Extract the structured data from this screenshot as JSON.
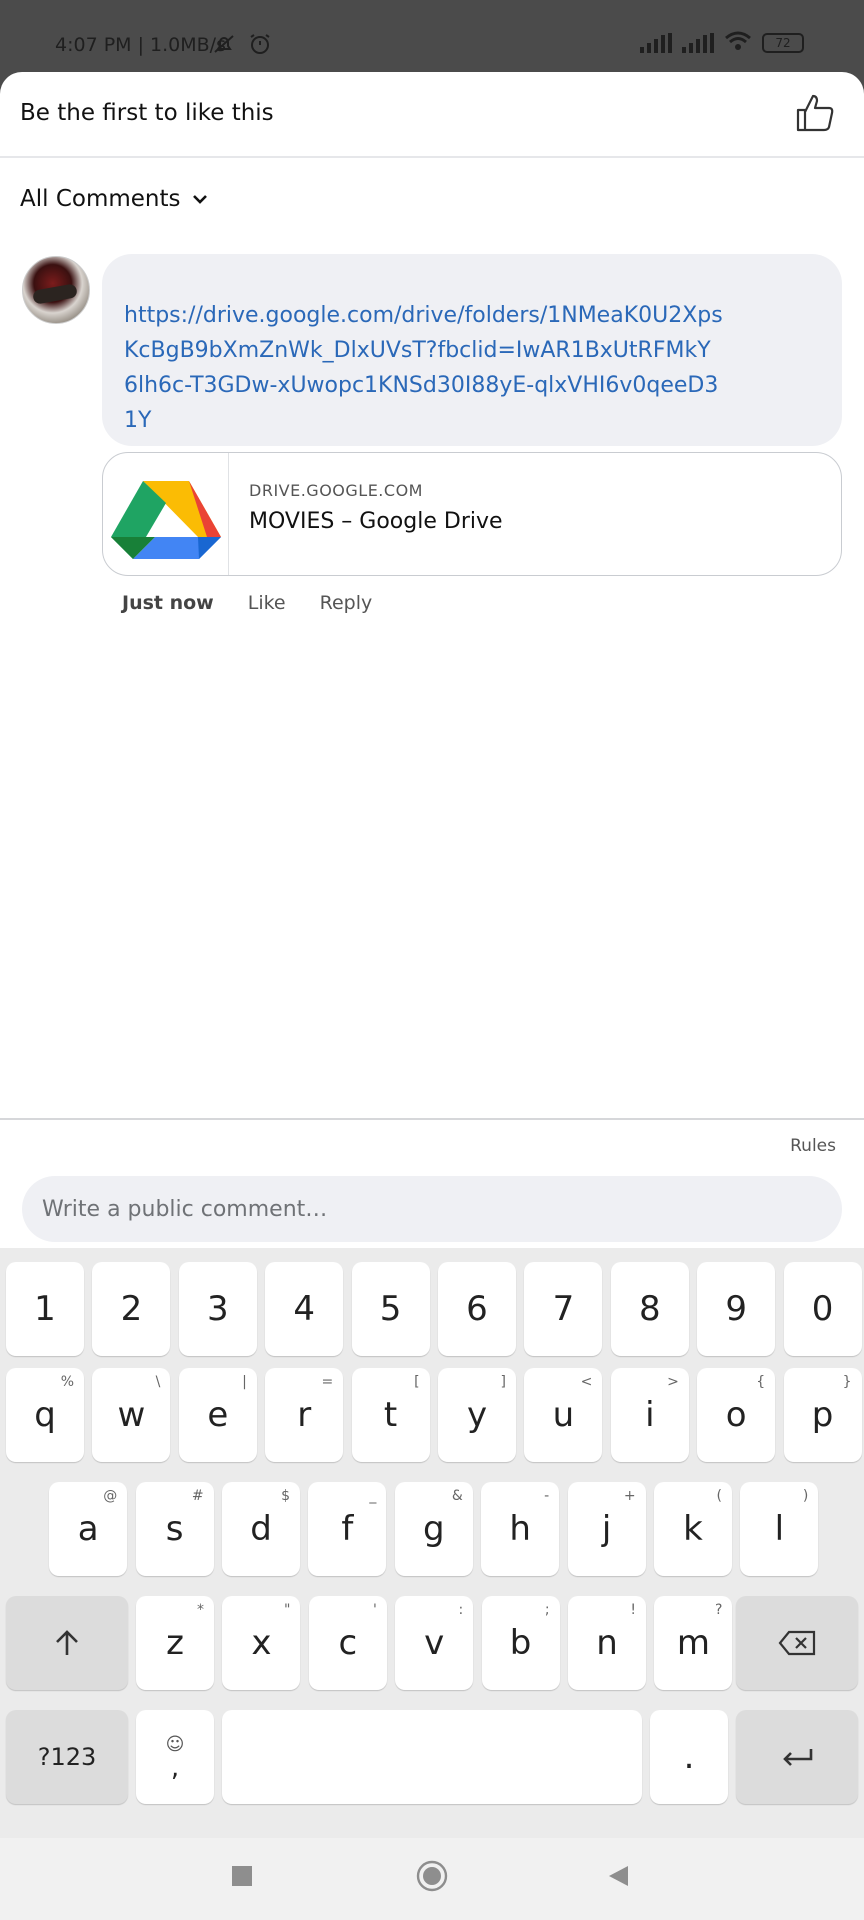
{
  "status_bar": {
    "time_text": "4:07 PM | 1.0MB/s",
    "battery": "72"
  },
  "likes": {
    "text": "Be the first to like this"
  },
  "comments_filter": {
    "label": "All Comments"
  },
  "comment": {
    "link": "https://drive.google.com/drive/folders/1NMeaK0U2XpsKcBgB9bXmZnWk_DlxUVsT?fbclid=IwAR1BxUtRFMkY6lh6c-T3GDw-xUwopc1KNSd30I88yE-qlxVHI6v0qeeD31Y",
    "card_domain": "DRIVE.GOOGLE.COM",
    "card_title": "MOVIES – Google Drive",
    "time": "Just now",
    "like_label": "Like",
    "reply_label": "Reply"
  },
  "composer": {
    "rules_label": "Rules",
    "placeholder": "Write a public comment…"
  },
  "keyboard": {
    "numbers": [
      "1",
      "2",
      "3",
      "4",
      "5",
      "6",
      "7",
      "8",
      "9",
      "0"
    ],
    "row1": [
      {
        "k": "q",
        "h": "%"
      },
      {
        "k": "w",
        "h": "\\"
      },
      {
        "k": "e",
        "h": "|"
      },
      {
        "k": "r",
        "h": "="
      },
      {
        "k": "t",
        "h": "["
      },
      {
        "k": "y",
        "h": "]"
      },
      {
        "k": "u",
        "h": "<"
      },
      {
        "k": "i",
        "h": ">"
      },
      {
        "k": "o",
        "h": "{"
      },
      {
        "k": "p",
        "h": "}"
      }
    ],
    "row2": [
      {
        "k": "a",
        "h": "@"
      },
      {
        "k": "s",
        "h": "#"
      },
      {
        "k": "d",
        "h": "$"
      },
      {
        "k": "f",
        "h": "_"
      },
      {
        "k": "g",
        "h": "&"
      },
      {
        "k": "h",
        "h": "-"
      },
      {
        "k": "j",
        "h": "+"
      },
      {
        "k": "k",
        "h": "("
      },
      {
        "k": "l",
        "h": ")"
      }
    ],
    "row3": [
      {
        "k": "z",
        "h": "*"
      },
      {
        "k": "x",
        "h": "\""
      },
      {
        "k": "c",
        "h": "'"
      },
      {
        "k": "v",
        "h": ":"
      },
      {
        "k": "b",
        "h": ";"
      },
      {
        "k": "n",
        "h": "!"
      },
      {
        "k": "m",
        "h": "?"
      }
    ],
    "symbols_label": "?123",
    "comma": ",",
    "period": "."
  }
}
